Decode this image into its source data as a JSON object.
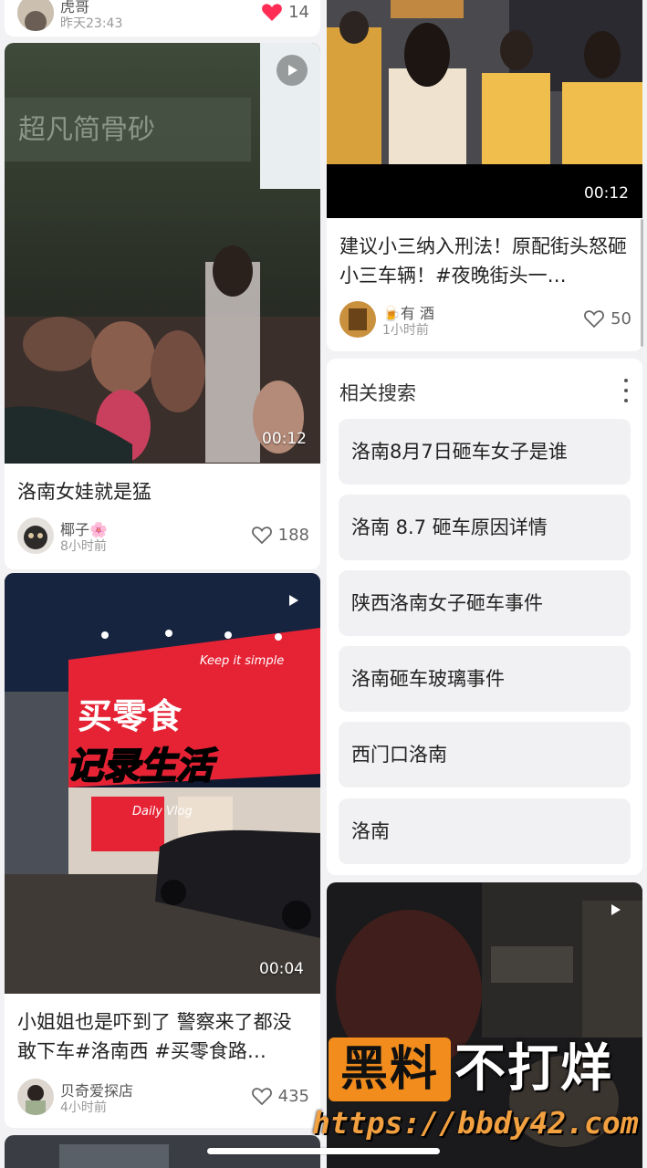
{
  "left_column": {
    "top_card": {
      "author": "虎哥",
      "time": "昨天23:43",
      "likes": "14"
    },
    "card1": {
      "duration": "00:12",
      "title": "洛南女娃就是猛",
      "author": "椰子🌸",
      "time": "8小时前",
      "likes": "188"
    },
    "card2": {
      "duration": "00:04",
      "title": "小姐姐也是吓到了 警察来了都没敢下车#洛南西 #买零食路…",
      "author": "贝奇爱探店",
      "time": "4小时前",
      "likes": "435",
      "thumb_texts": {
        "keep": "Keep it simple",
        "record": "记录生活",
        "vlog": "Daily Vlog",
        "sign": "买零食"
      }
    }
  },
  "right_column": {
    "card1": {
      "duration": "00:12",
      "title": "建议小三纳入刑法！原配街头怒砸小三车辆！#夜晚街头一…",
      "author": "🍺有 酒",
      "time": "1小时前",
      "likes": "50"
    },
    "related": {
      "heading": "相关搜索",
      "items": [
        "洛南8月7日砸车女子是谁",
        "洛南 8.7 砸车原因详情",
        "陕西洛南女子砸车事件",
        "洛南砸车玻璃事件",
        "西门口洛南",
        "洛南"
      ]
    }
  },
  "watermark": {
    "badge": "黑料",
    "text": "不打烊",
    "url": "https://bbdy42.com"
  },
  "colors": {
    "like_red": "#ff2d55",
    "watermark_orange": "#f28c1d"
  }
}
